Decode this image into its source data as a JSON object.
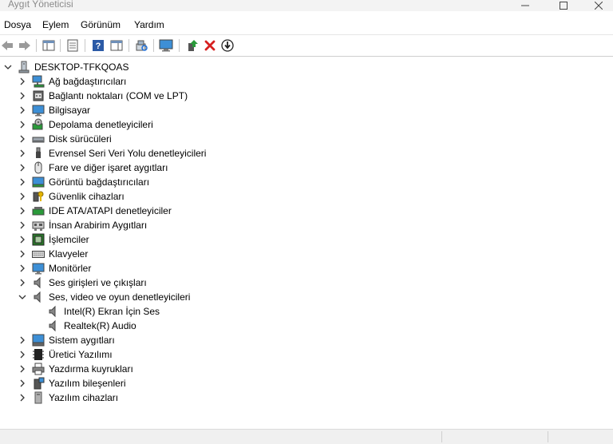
{
  "window": {
    "title": "Aygıt Yöneticisi"
  },
  "menu": {
    "items": [
      "Dosya",
      "Eylem",
      "Görünüm",
      "Yardım"
    ]
  },
  "tree": {
    "root": "DESKTOP-TFKQOAS",
    "categories": [
      "Ağ bağdaştırıcıları",
      "Bağlantı noktaları (COM ve LPT)",
      "Bilgisayar",
      "Depolama denetleyicileri",
      "Disk sürücüleri",
      "Evrensel Seri Veri Yolu denetleyicileri",
      "Fare ve diğer işaret aygıtları",
      "Görüntü bağdaştırıcıları",
      "Güvenlik cihazları",
      "IDE ATA/ATAPI denetleyiciler",
      "İnsan Arabirim Aygıtları",
      "İşlemciler",
      "Klavyeler",
      "Monitörler",
      "Ses girişleri ve çıkışları",
      "Ses, video ve oyun denetleyicileri",
      "Sistem aygıtları",
      "Üretici Yazılımı",
      "Yazdırma kuyrukları",
      "Yazılım bileşenleri",
      "Yazılım cihazları"
    ],
    "sound_devices": [
      "Intel(R) Ekran İçin Ses",
      "Realtek(R) Audio"
    ]
  },
  "colors": {
    "accent_blue": "#1e6fd9",
    "delete_red": "#d62020",
    "enable_green": "#2a9a3a"
  }
}
